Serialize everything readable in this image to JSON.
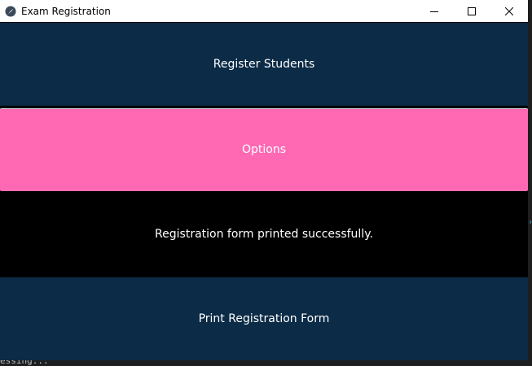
{
  "window": {
    "title": "Exam Registration",
    "icon": "feather-icon"
  },
  "controls": {
    "minimize_icon": "minimize-icon",
    "maximize_icon": "maximize-icon",
    "close_icon": "close-icon"
  },
  "buttons": {
    "register_label": "Register Students",
    "options_label": "Options",
    "print_label": "Print Registration Form"
  },
  "status": {
    "message": "Registration form printed successfully."
  },
  "background": {
    "terminal_text": "essing..."
  },
  "colors": {
    "button_dark": "#0b2b47",
    "button_pink": "#ff69b4",
    "status_bg": "#000000",
    "text": "#ffffff"
  }
}
